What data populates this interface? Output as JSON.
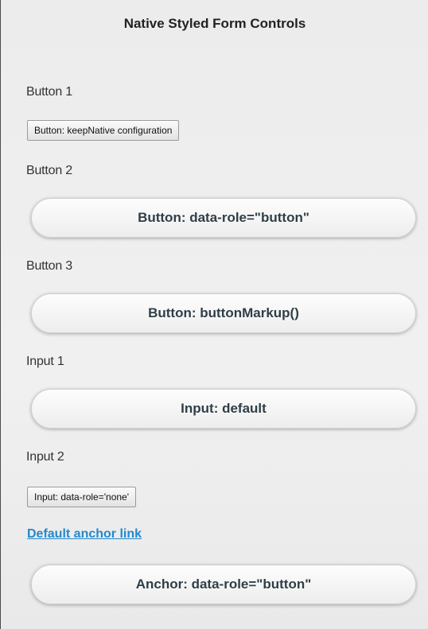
{
  "header": {
    "title": "Native Styled Form Controls"
  },
  "sections": {
    "button1": {
      "label": "Button 1",
      "control": "Button: keepNative configuration"
    },
    "button2": {
      "label": "Button 2",
      "control": "Button: data-role=\"button\""
    },
    "button3": {
      "label": "Button 3",
      "control": "Button: buttonMarkup()"
    },
    "input1": {
      "label": "Input 1",
      "control": "Input: default"
    },
    "input2": {
      "label": "Input 2",
      "control": "Input: data-role='none'"
    }
  },
  "links": {
    "default_anchor": "Default anchor link",
    "anchor_button": "Anchor: data-role=\"button\""
  },
  "colors": {
    "link": "#2489ce",
    "button_text": "#2f3e46",
    "background": "#ececec"
  }
}
